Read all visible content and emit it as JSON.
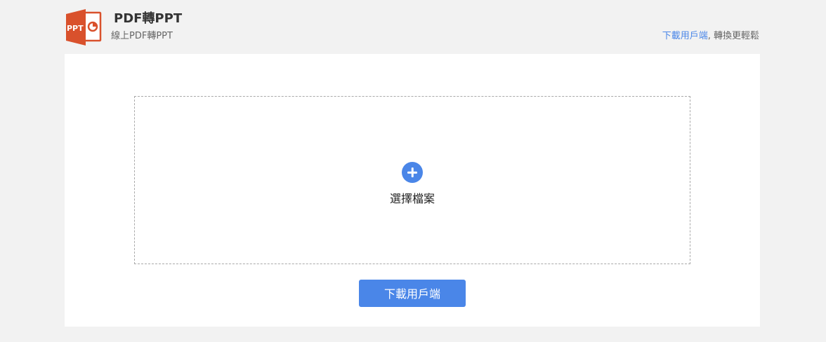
{
  "header": {
    "logo_text": "PPT",
    "title": "PDF轉PPT",
    "subtitle": "線上PDF轉PPT",
    "promo_link": "下載用戶端",
    "promo_text": ", 轉換更輕鬆"
  },
  "upload": {
    "select_label": "選擇檔案"
  },
  "actions": {
    "download_label": "下載用戶端"
  },
  "colors": {
    "accent": "#4a86e8",
    "logo": "#d9512c",
    "page_background": "#f2f2f2",
    "panel_background": "#ffffff"
  }
}
